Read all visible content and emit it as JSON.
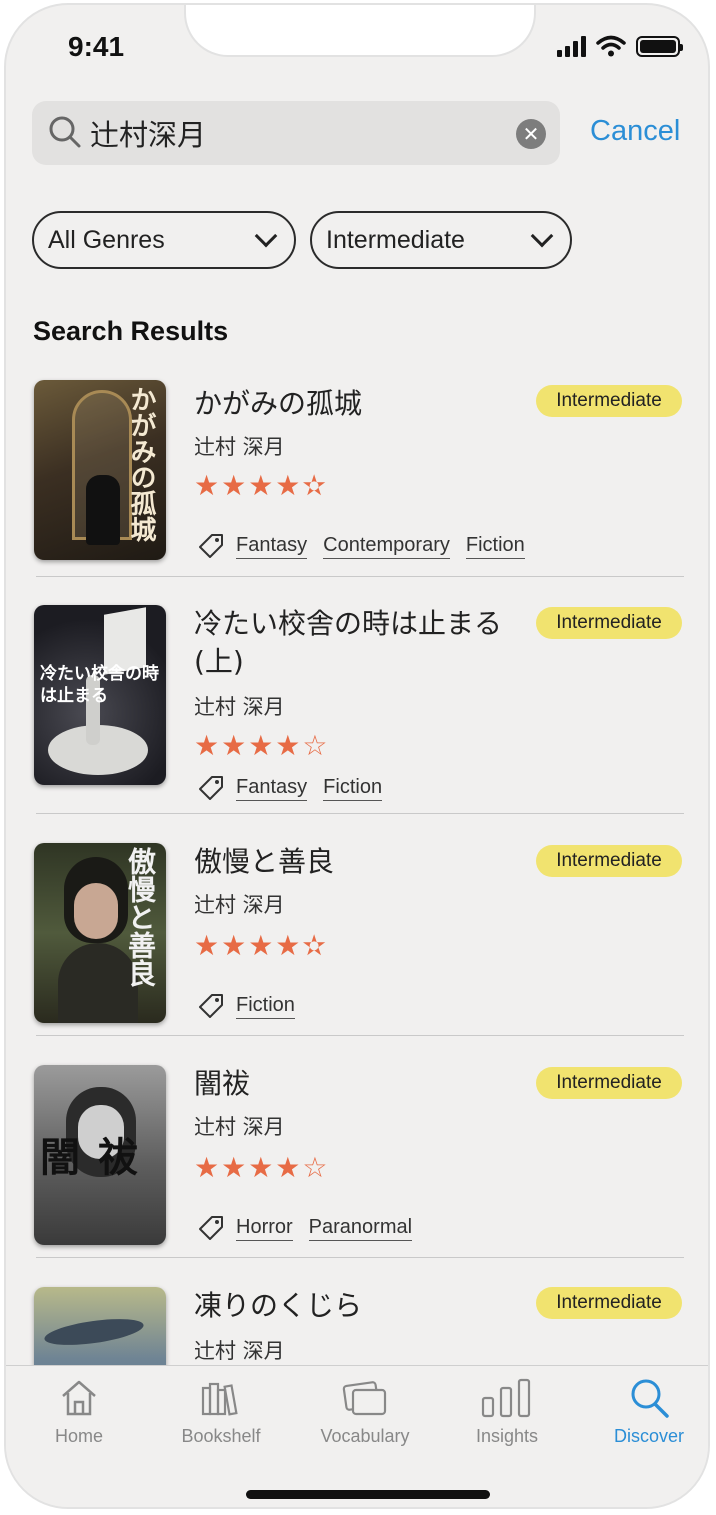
{
  "status": {
    "time": "9:41"
  },
  "search": {
    "query": "辻村深月",
    "cancel_label": "Cancel"
  },
  "filters": {
    "genre": "All Genres",
    "level": "Intermediate"
  },
  "section_title": "Search Results",
  "results": [
    {
      "title": "かがみの孤城",
      "author": "辻村 深月",
      "rating": 4.5,
      "stars": "★★★★✫",
      "level": "Intermediate",
      "tags": [
        "Fantasy",
        "Contemporary",
        "Fiction"
      ],
      "cover_text": "かがみの孤城"
    },
    {
      "title": "冷たい校舎の時は止まる(上)",
      "author": "辻村 深月",
      "rating": 4,
      "stars": "★★★★☆",
      "level": "Intermediate",
      "tags": [
        "Fantasy",
        "Fiction"
      ],
      "cover_text": "冷たい校舎の時は止まる"
    },
    {
      "title": "傲慢と善良",
      "author": "辻村 深月",
      "rating": 4.5,
      "stars": "★★★★✫",
      "level": "Intermediate",
      "tags": [
        "Fiction"
      ],
      "cover_text": "傲慢と善良"
    },
    {
      "title": "闇祓",
      "author": "辻村 深月",
      "rating": 4,
      "stars": "★★★★☆",
      "level": "Intermediate",
      "tags": [
        "Horror",
        "Paranormal"
      ],
      "cover_text": "闇祓"
    },
    {
      "title": "凍りのくじら",
      "author": "辻村 深月",
      "level": "Intermediate"
    }
  ],
  "tabbar": {
    "home": "Home",
    "bookshelf": "Bookshelf",
    "vocabulary": "Vocabulary",
    "insights": "Insights",
    "discover": "Discover"
  },
  "colors": {
    "accent": "#2b8ed6",
    "star": "#e76b45",
    "badge": "#f1e36f"
  }
}
